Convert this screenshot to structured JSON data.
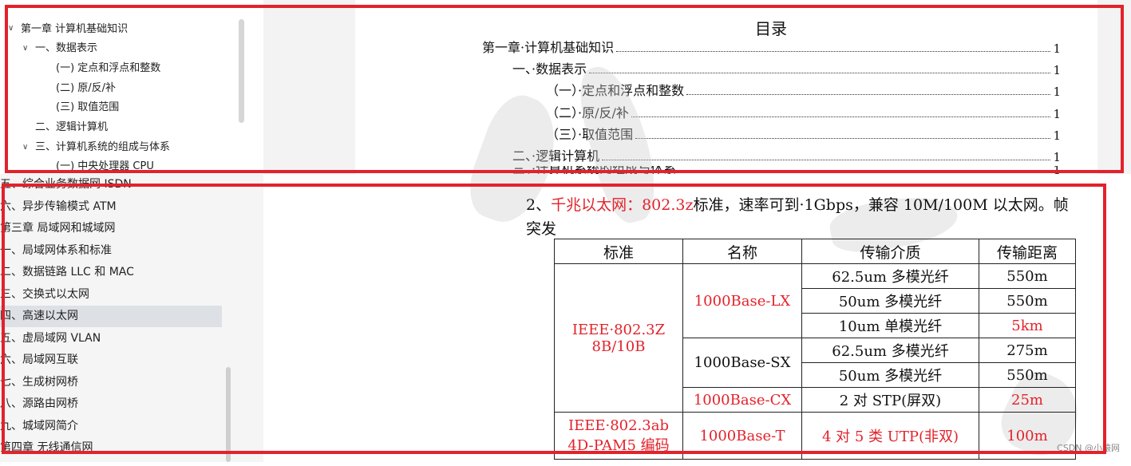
{
  "nav_top": {
    "items": [
      {
        "label": "第一章  计算机基础知识",
        "expanded": true
      },
      {
        "label": "一、数据表示",
        "expanded": true
      },
      {
        "label": "(一) 定点和浮点和整数"
      },
      {
        "label": "(二) 原/反/补"
      },
      {
        "label": "(三) 取值范围"
      },
      {
        "label": "二、逻辑计算机"
      },
      {
        "label": "三、计算机系统的组成与体系",
        "expanded": true
      },
      {
        "label": "(一) 中央处理器 CPU"
      }
    ]
  },
  "toc": {
    "title": "目录",
    "rows": [
      {
        "text": "第一章·计算机基础知识",
        "page": "1"
      },
      {
        "text": "一、·数据表示",
        "page": "1"
      },
      {
        "text": "（一）·定点和浮点和整数",
        "page": "1"
      },
      {
        "text": "（二）·原/反/补",
        "page": "1"
      },
      {
        "text": "（三）·取值范围",
        "page": "1"
      },
      {
        "text": "二、·逻辑计算机",
        "page": "1"
      },
      {
        "text": "三、·计算机系统的组成与体系",
        "page": "1"
      }
    ]
  },
  "nav_bottom": {
    "items": [
      {
        "label": "五、综合业务数据网 ISDN"
      },
      {
        "label": "六、异步传输模式 ATM"
      },
      {
        "label": "第三章  局域网和城域网"
      },
      {
        "label": "一、局域网体系和标准"
      },
      {
        "label": "二、数据链路 LLC 和 MAC"
      },
      {
        "label": "三、交换式以太网"
      },
      {
        "label": "四、高速以太网",
        "selected": true
      },
      {
        "label": "五、虚局域网 VLAN"
      },
      {
        "label": "六、局域网互联"
      },
      {
        "label": "七、生成树网桥"
      },
      {
        "label": "八、源路由网桥"
      },
      {
        "label": "九、城域网简介"
      },
      {
        "label": "第四章  无线通信网"
      }
    ]
  },
  "paragraph": {
    "prefix": "2、",
    "highlight": "千兆以太网：802.3z",
    "rest": "标准，速率可到·1Gbps，兼容 10M/100M 以太网。帧",
    "line2": "突发"
  },
  "table": {
    "headers": [
      "标准",
      "名称",
      "传输介质",
      "传输距离"
    ],
    "groups": [
      {
        "standard": [
          "IEEE·802.3Z",
          "8B/10B"
        ],
        "standard_red": true,
        "names": [
          {
            "name": "1000Base-LX",
            "red": true,
            "rows": [
              {
                "medium": "62.5um 多模光纤",
                "distance": "550m",
                "medium_red": false,
                "distance_red": false
              },
              {
                "medium": "50um 多模光纤",
                "distance": "550m",
                "medium_red": false,
                "distance_red": false
              },
              {
                "medium": "10um 单模光纤",
                "distance": "5km",
                "medium_red": false,
                "distance_red": true
              }
            ]
          },
          {
            "name": "1000Base-SX",
            "red": false,
            "rows": [
              {
                "medium": "62.5um 多模光纤",
                "distance": "275m",
                "medium_red": false,
                "distance_red": false
              },
              {
                "medium": "50um 多模光纤",
                "distance": "550m",
                "medium_red": false,
                "distance_red": false
              }
            ]
          },
          {
            "name": "1000Base-CX",
            "red": true,
            "rows": [
              {
                "medium": "2 对 STP(屏双)",
                "distance": "25m",
                "medium_red": false,
                "distance_red": true
              }
            ]
          }
        ]
      },
      {
        "standard": [
          "IEEE·802.3ab",
          "4D-PAM5 编码"
        ],
        "standard_red": true,
        "names": [
          {
            "name": "1000Base-T",
            "red": true,
            "rows": [
              {
                "medium": "4 对 5 类 UTP(非双)",
                "distance": "100m",
                "medium_red": true,
                "distance_red": true
              }
            ]
          }
        ]
      }
    ]
  },
  "watermark": "CSDN @小猿网",
  "colors": {
    "highlight_red": "#e3222b",
    "selected_bg": "#dde1e6"
  }
}
